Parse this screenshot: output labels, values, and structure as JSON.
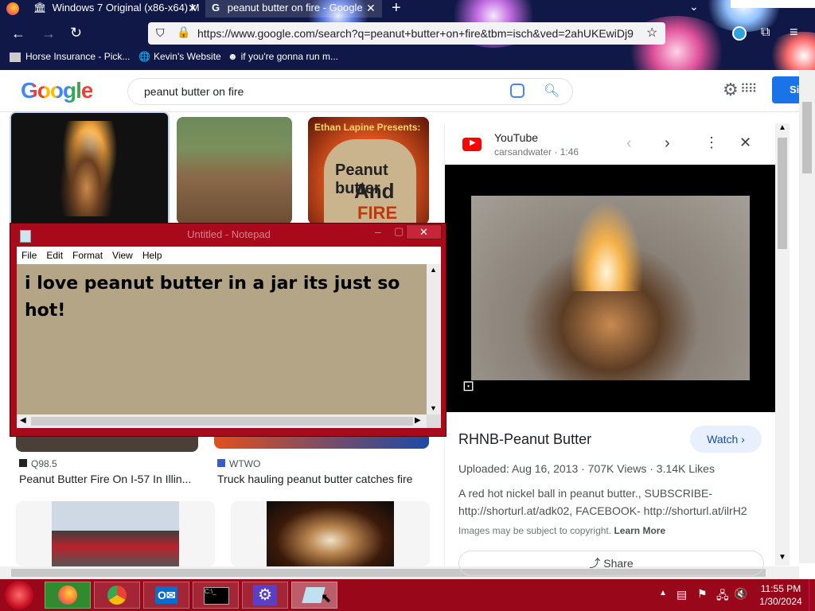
{
  "browser": {
    "tabs": [
      {
        "label": "Windows 7 Original (x86-x64) M"
      },
      {
        "label": "peanut butter on fire - Google"
      }
    ],
    "url": "https://www.google.com/search?q=peanut+butter+on+fire&tbm=isch&ved=2ahUKEwiDj9",
    "bookmarks": [
      {
        "label": "Horse Insurance - Pick..."
      },
      {
        "label": "Kevin's Website"
      },
      {
        "label": "if you're gonna run m..."
      }
    ]
  },
  "google": {
    "logo": "Google",
    "query": "peanut butter on fire",
    "signin": "Si"
  },
  "results": [
    {
      "source": "Q98.5",
      "title": "Peanut Butter Fire On I-57 In Illin..."
    },
    {
      "source": "WTWO",
      "title": "Truck hauling peanut butter catches fire"
    }
  ],
  "thumb3_text": {
    "line1": "Ethan Lapine Presents:",
    "line2": "Peanut butter",
    "line3": "And",
    "line4": "FIRE"
  },
  "panel": {
    "site": "YouTube",
    "channel": "carsandwater",
    "duration": "1:46",
    "title": "RHNB-Peanut Butter",
    "watch": "Watch",
    "meta": "Uploaded: Aug 16, 2013 · 707K Views · 3.14K Likes",
    "description": "A red hot nickel ball in peanut butter., SUBSCRIBE- http://shorturl.at/adk02, FACEBOOK- http://shorturl.at/ilrH2",
    "copyright": "Images may be subject to copyright.",
    "learn_more": "Learn More",
    "share": "Share"
  },
  "notepad": {
    "title": "Untitled - Notepad",
    "menu": [
      "File",
      "Edit",
      "Format",
      "View",
      "Help"
    ],
    "text": "i love peanut butter in a jar its just so hot!"
  },
  "taskbar": {
    "time": "11:55 PM",
    "date": "1/30/2024"
  },
  "colors": {
    "notepad_frame": "#a8091b",
    "notepad_bg": "#b3a585",
    "taskbar": "#98071a",
    "google_blue": "#1a73e8"
  }
}
